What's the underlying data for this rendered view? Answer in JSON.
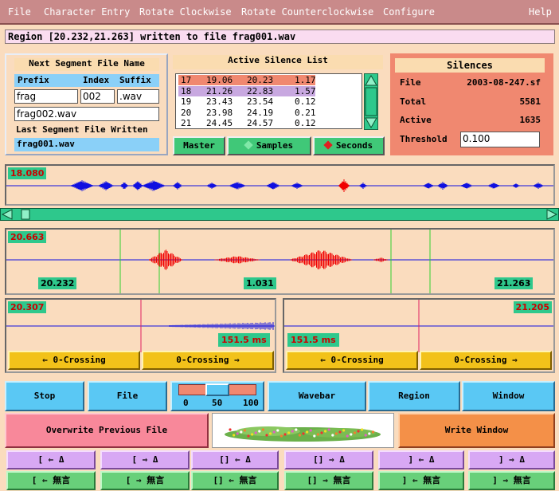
{
  "menu": {
    "items": [
      "File",
      "Character Entry",
      "Rotate Clockwise",
      "Rotate Counterclockwise",
      "Configure"
    ],
    "help": "Help"
  },
  "status": "Region [20.232,21.263] written to file frag001.wav",
  "segment": {
    "title": "Next Segment File Name",
    "prefix_label": "Prefix",
    "index_label": "Index",
    "suffix_label": "Suffix",
    "prefix": "frag",
    "index": "002",
    "suffix": ".wav",
    "next_file": "frag002.wav",
    "last_label": "Last Segment File Written",
    "last_file": "frag001.wav"
  },
  "silence_list": {
    "title": "Active Silence List",
    "rows": [
      [
        "17",
        "19.06",
        "20.23",
        "1.17"
      ],
      [
        "18",
        "21.26",
        "22.83",
        "1.57"
      ],
      [
        "19",
        "23.43",
        "23.54",
        "0.12"
      ],
      [
        "20",
        "23.98",
        "24.19",
        "0.21"
      ],
      [
        "21",
        "24.45",
        "24.57",
        "0.12"
      ]
    ],
    "master": "Master",
    "samples": "Samples",
    "seconds": "Seconds"
  },
  "silences": {
    "title": "Silences",
    "file_label": "File",
    "file": "2003-08-247.sf",
    "total_label": "Total",
    "total": "5581",
    "active_label": "Active",
    "active": "1635",
    "threshold_label": "Threshold",
    "threshold": "0.100"
  },
  "overview": {
    "time": "18.080"
  },
  "main": {
    "time": "20.663",
    "left": "20.232",
    "mid": "1.031",
    "right": "21.263"
  },
  "left_zoom": {
    "time": "20.307",
    "ms": "151.5 ms",
    "back": "⇐ 0-Crossing",
    "fwd": "0-Crossing ⇒"
  },
  "right_zoom": {
    "time": "21.205",
    "ms": "151.5 ms",
    "back": "⇐ 0-Crossing",
    "fwd": "0-Crossing ⇒"
  },
  "controls": {
    "stop": "Stop",
    "file": "File",
    "scale": [
      "0",
      "50",
      "100"
    ],
    "scale_value": 0.5,
    "wavebar": "Wavebar",
    "region": "Region",
    "window": "Window",
    "overwrite": "Overwrite Previous File",
    "write_window": "Write Window"
  },
  "edit_row1": [
    "[ ⇐ Δ",
    "[ ⇒ Δ",
    "[] ⇐ Δ",
    "[] ⇒ Δ",
    "] ⇐ Δ",
    "] ⇒ Δ"
  ],
  "edit_row2": [
    "[ ⇐ 無言",
    "[ ⇒ 無言",
    "[] ⇐ 無言",
    "[] ⇒ 無言",
    "] ⇐ 無言",
    "] ⇒ 無言"
  ],
  "colors": {
    "menubar": "#c98a8a",
    "accent": "#2ec88c",
    "wave_blue": "#1010e0",
    "wave_red": "#f00000",
    "selected_row": "#f08870"
  }
}
